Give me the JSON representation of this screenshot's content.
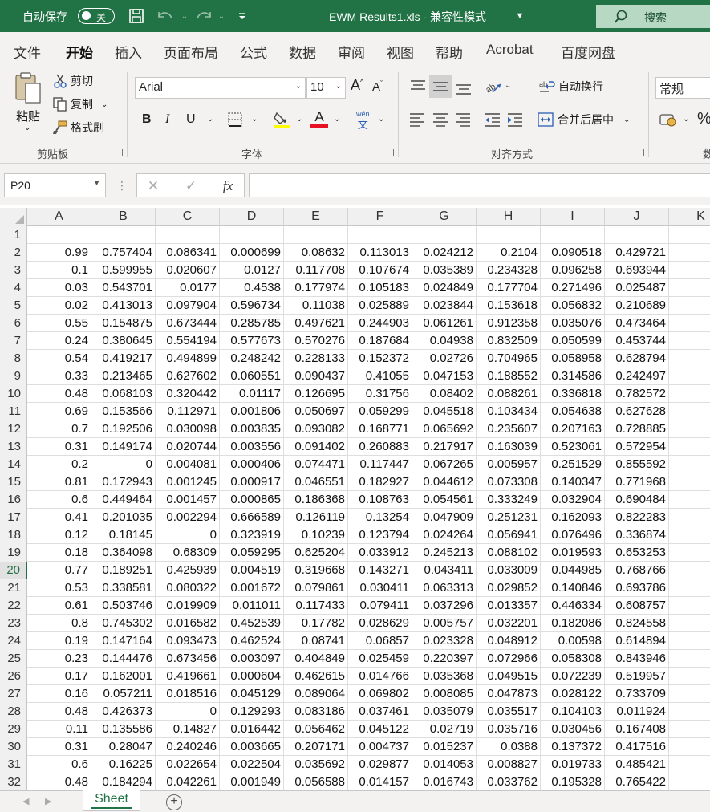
{
  "titlebar": {
    "autosave_label": "自动保存",
    "autosave_state": "关",
    "file_title": "EWM Results1.xls  -  兼容性模式",
    "search_label": "搜索"
  },
  "ribbon_tabs": [
    "文件",
    "开始",
    "插入",
    "页面布局",
    "公式",
    "数据",
    "审阅",
    "视图",
    "帮助",
    "Acrobat",
    "百度网盘"
  ],
  "active_tab": "开始",
  "clipboard": {
    "paste": "粘贴",
    "cut": "剪切",
    "copy": "复制",
    "format_painter": "格式刷",
    "group_label": "剪贴板"
  },
  "font": {
    "name": "Arial",
    "size": "10",
    "bold": "B",
    "italic": "I",
    "underline": "U",
    "font_color_glyph": "A",
    "phonetic": "文",
    "phonetic_top": "wén",
    "group_label": "字体"
  },
  "alignment": {
    "wrap_text": "自动换行",
    "merge_center": "合并后居中",
    "group_label": "对齐方式"
  },
  "number": {
    "format": "常规",
    "percent": "%",
    "group_label_partial": "数"
  },
  "formula_bar": {
    "name_box": "P20",
    "fx": "fx",
    "formula": ""
  },
  "columns": [
    "A",
    "B",
    "C",
    "D",
    "E",
    "F",
    "G",
    "H",
    "I",
    "J",
    "K"
  ],
  "selected_row": "20",
  "rows": [
    {
      "n": "1",
      "cells": [
        "",
        "",
        "",
        "",
        "",
        "",
        "",
        "",
        "",
        ""
      ]
    },
    {
      "n": "2",
      "cells": [
        "0.99",
        "0.757404",
        "0.086341",
        "0.000699",
        "0.08632",
        "0.113013",
        "0.024212",
        "0.2104",
        "0.090518",
        "0.429721"
      ]
    },
    {
      "n": "3",
      "cells": [
        "0.1",
        "0.599955",
        "0.020607",
        "0.0127",
        "0.117708",
        "0.107674",
        "0.035389",
        "0.234328",
        "0.096258",
        "0.693944"
      ]
    },
    {
      "n": "4",
      "cells": [
        "0.03",
        "0.543701",
        "0.0177",
        "0.4538",
        "0.177974",
        "0.105183",
        "0.024849",
        "0.177704",
        "0.271496",
        "0.025487"
      ]
    },
    {
      "n": "5",
      "cells": [
        "0.02",
        "0.413013",
        "0.097904",
        "0.596734",
        "0.11038",
        "0.025889",
        "0.023844",
        "0.153618",
        "0.056832",
        "0.210689"
      ]
    },
    {
      "n": "6",
      "cells": [
        "0.55",
        "0.154875",
        "0.673444",
        "0.285785",
        "0.497621",
        "0.244903",
        "0.061261",
        "0.912358",
        "0.035076",
        "0.473464"
      ]
    },
    {
      "n": "7",
      "cells": [
        "0.24",
        "0.380645",
        "0.554194",
        "0.577673",
        "0.570276",
        "0.187684",
        "0.04938",
        "0.832509",
        "0.050599",
        "0.453744"
      ]
    },
    {
      "n": "8",
      "cells": [
        "0.54",
        "0.419217",
        "0.494899",
        "0.248242",
        "0.228133",
        "0.152372",
        "0.02726",
        "0.704965",
        "0.058958",
        "0.628794"
      ]
    },
    {
      "n": "9",
      "cells": [
        "0.33",
        "0.213465",
        "0.627602",
        "0.060551",
        "0.090437",
        "0.41055",
        "0.047153",
        "0.188552",
        "0.314586",
        "0.242497"
      ]
    },
    {
      "n": "10",
      "cells": [
        "0.48",
        "0.068103",
        "0.320442",
        "0.01117",
        "0.126695",
        "0.31756",
        "0.08402",
        "0.088261",
        "0.336818",
        "0.782572"
      ]
    },
    {
      "n": "11",
      "cells": [
        "0.69",
        "0.153566",
        "0.112971",
        "0.001806",
        "0.050697",
        "0.059299",
        "0.045518",
        "0.103434",
        "0.054638",
        "0.627628"
      ]
    },
    {
      "n": "12",
      "cells": [
        "0.7",
        "0.192506",
        "0.030098",
        "0.003835",
        "0.093082",
        "0.168771",
        "0.065692",
        "0.235607",
        "0.207163",
        "0.728885"
      ]
    },
    {
      "n": "13",
      "cells": [
        "0.31",
        "0.149174",
        "0.020744",
        "0.003556",
        "0.091402",
        "0.260883",
        "0.217917",
        "0.163039",
        "0.523061",
        "0.572954"
      ]
    },
    {
      "n": "14",
      "cells": [
        "0.2",
        "0",
        "0.004081",
        "0.000406",
        "0.074471",
        "0.117447",
        "0.067265",
        "0.005957",
        "0.251529",
        "0.855592"
      ]
    },
    {
      "n": "15",
      "cells": [
        "0.81",
        "0.172943",
        "0.001245",
        "0.000917",
        "0.046551",
        "0.182927",
        "0.044612",
        "0.073308",
        "0.140347",
        "0.771968"
      ]
    },
    {
      "n": "16",
      "cells": [
        "0.6",
        "0.449464",
        "0.001457",
        "0.000865",
        "0.186368",
        "0.108763",
        "0.054561",
        "0.333249",
        "0.032904",
        "0.690484"
      ]
    },
    {
      "n": "17",
      "cells": [
        "0.41",
        "0.201035",
        "0.002294",
        "0.666589",
        "0.126119",
        "0.13254",
        "0.047909",
        "0.251231",
        "0.162093",
        "0.822283"
      ]
    },
    {
      "n": "18",
      "cells": [
        "0.12",
        "0.18145",
        "0",
        "0.323919",
        "0.10239",
        "0.123794",
        "0.024264",
        "0.056941",
        "0.076496",
        "0.336874"
      ]
    },
    {
      "n": "19",
      "cells": [
        "0.18",
        "0.364098",
        "0.68309",
        "0.059295",
        "0.625204",
        "0.033912",
        "0.245213",
        "0.088102",
        "0.019593",
        "0.653253"
      ]
    },
    {
      "n": "20",
      "cells": [
        "0.77",
        "0.189251",
        "0.425939",
        "0.004519",
        "0.319668",
        "0.143271",
        "0.043411",
        "0.033009",
        "0.044985",
        "0.768766"
      ]
    },
    {
      "n": "21",
      "cells": [
        "0.53",
        "0.338581",
        "0.080322",
        "0.001672",
        "0.079861",
        "0.030411",
        "0.063313",
        "0.029852",
        "0.140846",
        "0.693786"
      ]
    },
    {
      "n": "22",
      "cells": [
        "0.61",
        "0.503746",
        "0.019909",
        "0.011011",
        "0.117433",
        "0.079411",
        "0.037296",
        "0.013357",
        "0.446334",
        "0.608757"
      ]
    },
    {
      "n": "23",
      "cells": [
        "0.8",
        "0.745302",
        "0.016582",
        "0.452539",
        "0.17782",
        "0.028629",
        "0.005757",
        "0.032201",
        "0.182086",
        "0.824558"
      ]
    },
    {
      "n": "24",
      "cells": [
        "0.19",
        "0.147164",
        "0.093473",
        "0.462524",
        "0.08741",
        "0.06857",
        "0.023328",
        "0.048912",
        "0.00598",
        "0.614894"
      ]
    },
    {
      "n": "25",
      "cells": [
        "0.23",
        "0.144476",
        "0.673456",
        "0.003097",
        "0.404849",
        "0.025459",
        "0.220397",
        "0.072966",
        "0.058308",
        "0.843946"
      ]
    },
    {
      "n": "26",
      "cells": [
        "0.17",
        "0.162001",
        "0.419661",
        "0.000604",
        "0.462615",
        "0.014766",
        "0.035368",
        "0.049515",
        "0.072239",
        "0.519957"
      ]
    },
    {
      "n": "27",
      "cells": [
        "0.16",
        "0.057211",
        "0.018516",
        "0.045129",
        "0.089064",
        "0.069802",
        "0.008085",
        "0.047873",
        "0.028122",
        "0.733709"
      ]
    },
    {
      "n": "28",
      "cells": [
        "0.48",
        "0.426373",
        "0",
        "0.129293",
        "0.083186",
        "0.037461",
        "0.035079",
        "0.035517",
        "0.104103",
        "0.011924"
      ]
    },
    {
      "n": "29",
      "cells": [
        "0.11",
        "0.135586",
        "0.14827",
        "0.016442",
        "0.056462",
        "0.045122",
        "0.02719",
        "0.035716",
        "0.030456",
        "0.167408"
      ]
    },
    {
      "n": "30",
      "cells": [
        "0.31",
        "0.28047",
        "0.240246",
        "0.003665",
        "0.207171",
        "0.004737",
        "0.015237",
        "0.0388",
        "0.137372",
        "0.417516"
      ]
    },
    {
      "n": "31",
      "cells": [
        "0.6",
        "0.16225",
        "0.022654",
        "0.022504",
        "0.035692",
        "0.029877",
        "0.014053",
        "0.008827",
        "0.019733",
        "0.485421"
      ]
    },
    {
      "n": "32",
      "cells": [
        "0.48",
        "0.184294",
        "0.042261",
        "0.001949",
        "0.056588",
        "0.014157",
        "0.016743",
        "0.033762",
        "0.195328",
        "0.765422"
      ]
    }
  ],
  "sheet_tab": "Sheet",
  "colors": {
    "accent": "#217346",
    "ribbon_bg": "#f3f2f1",
    "highlight_yellow": "#ffff00",
    "font_red": "#e81123"
  }
}
